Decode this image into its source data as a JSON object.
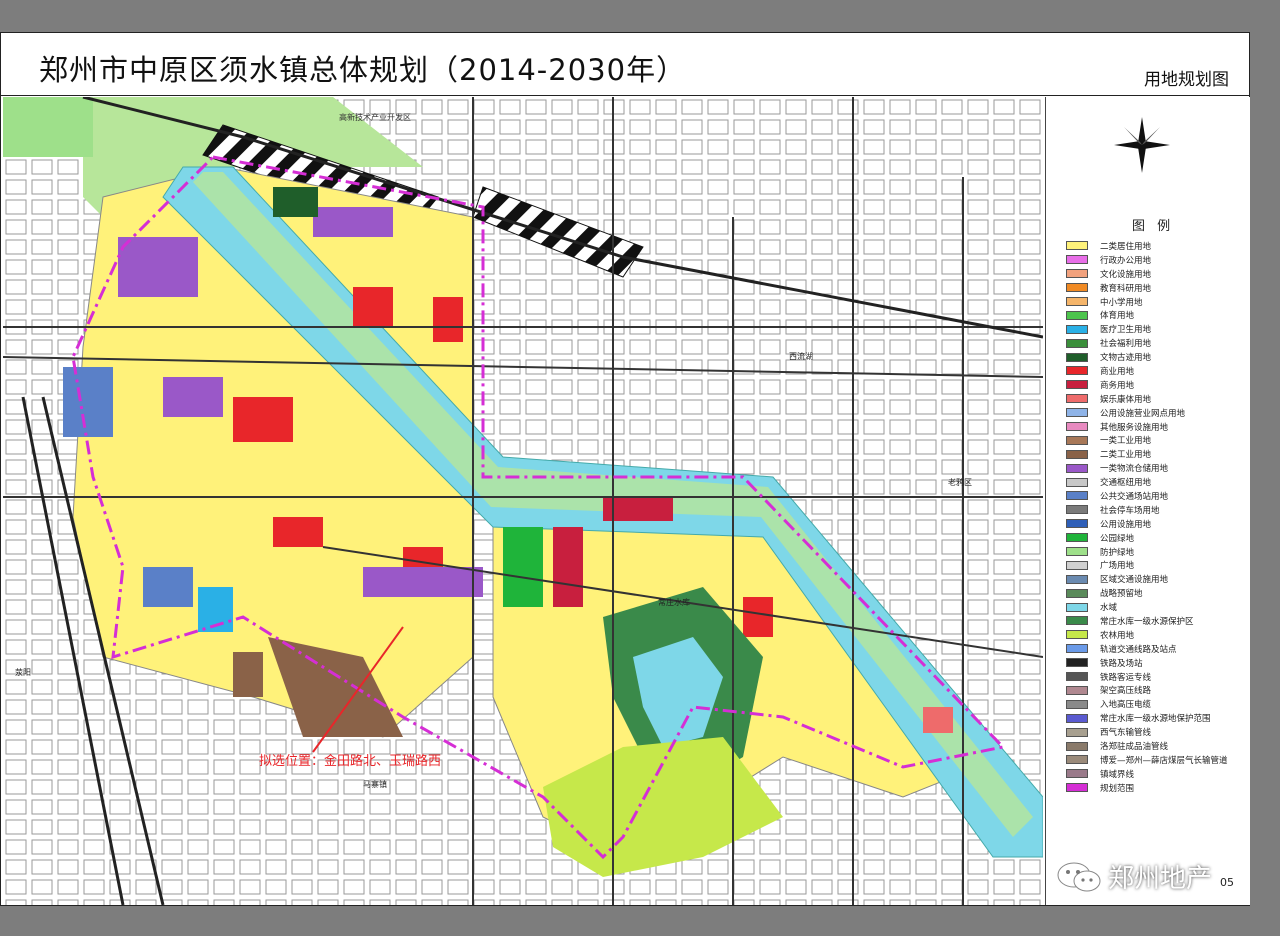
{
  "header": {
    "title": "郑州市中原区须水镇总体规划（2014-2030年）",
    "sheet_name": "用地规划图"
  },
  "map": {
    "labels": {
      "tech_zone": "高新技术产业开发区",
      "site": "拟选位置：金田路北、玉瑞路西",
      "reservoir": "常庄水库",
      "laoya": "老鸦区",
      "xiliu_lake": "西流湖",
      "mazhai": "马寨镇",
      "xingyang": "荥阳"
    }
  },
  "legend": {
    "title": "图 例",
    "items": [
      {
        "label": "二类居住用地",
        "color": "#fff27a"
      },
      {
        "label": "行政办公用地",
        "color": "#e86ee8"
      },
      {
        "label": "文化设施用地",
        "color": "#f2a27e"
      },
      {
        "label": "教育科研用地",
        "color": "#f08a24"
      },
      {
        "label": "中小学用地",
        "color": "#f5b56a"
      },
      {
        "label": "体育用地",
        "color": "#4dc44d"
      },
      {
        "label": "医疗卫生用地",
        "color": "#2ab0e6"
      },
      {
        "label": "社会福利用地",
        "color": "#3b8f3b"
      },
      {
        "label": "文物古迹用地",
        "color": "#1f5e2a"
      },
      {
        "label": "商业用地",
        "color": "#e8262a"
      },
      {
        "label": "商务用地",
        "color": "#c81f3e"
      },
      {
        "label": "娱乐康体用地",
        "color": "#ee6b6b"
      },
      {
        "label": "公用设施营业网点用地",
        "color": "#8fb4e8"
      },
      {
        "label": "其他服务设施用地",
        "color": "#e88ac0"
      },
      {
        "label": "一类工业用地",
        "color": "#a87858"
      },
      {
        "label": "二类工业用地",
        "color": "#8a6248"
      },
      {
        "label": "一类物流仓储用地",
        "color": "#9a58c8"
      },
      {
        "label": "交通枢纽用地",
        "color": "#c8c8c8"
      },
      {
        "label": "公共交通场站用地",
        "color": "#5a80c8"
      },
      {
        "label": "社会停车场用地",
        "color": "#7a7a7a"
      },
      {
        "label": "公用设施用地",
        "color": "#2f5fb8"
      },
      {
        "label": "公园绿地",
        "color": "#1fb43a"
      },
      {
        "label": "防护绿地",
        "color": "#9ee08a"
      },
      {
        "label": "广场用地",
        "color": "#d0d0d0"
      },
      {
        "label": "区域交通设施用地",
        "color": "#6a8ab0"
      },
      {
        "label": "战略预留地",
        "color": "#5a8a5a"
      },
      {
        "label": "水域",
        "color": "#7ed7e8"
      },
      {
        "label": "常庄水库一级水源保护区",
        "color": "#3a8a4a"
      },
      {
        "label": "农林用地",
        "color": "#c6e84a"
      },
      {
        "label": "轨道交通线路及站点",
        "color": "#6a9ae8"
      },
      {
        "label": "铁路及场站",
        "color": "#222222"
      },
      {
        "label": "铁路客运专线",
        "color": "#555555"
      },
      {
        "label": "架空高压线路",
        "color": "#b08890"
      },
      {
        "label": "入地高压电缆",
        "color": "#8a8a8a"
      },
      {
        "label": "常庄水库一级水源地保护范围",
        "color": "#5a5ad0"
      },
      {
        "label": "西气东输管线",
        "color": "#a8a090"
      },
      {
        "label": "洛郑驻成品油管线",
        "color": "#8a7a6a"
      },
      {
        "label": "博爱—郑州—薛店煤层气长输管道",
        "color": "#9a8a7a"
      },
      {
        "label": "镇域界线",
        "color": "#9a7a8a"
      },
      {
        "label": "规划范围",
        "color": "#d52ed5"
      }
    ]
  },
  "footer": {
    "watermark": "郑州地产",
    "page": "05"
  }
}
